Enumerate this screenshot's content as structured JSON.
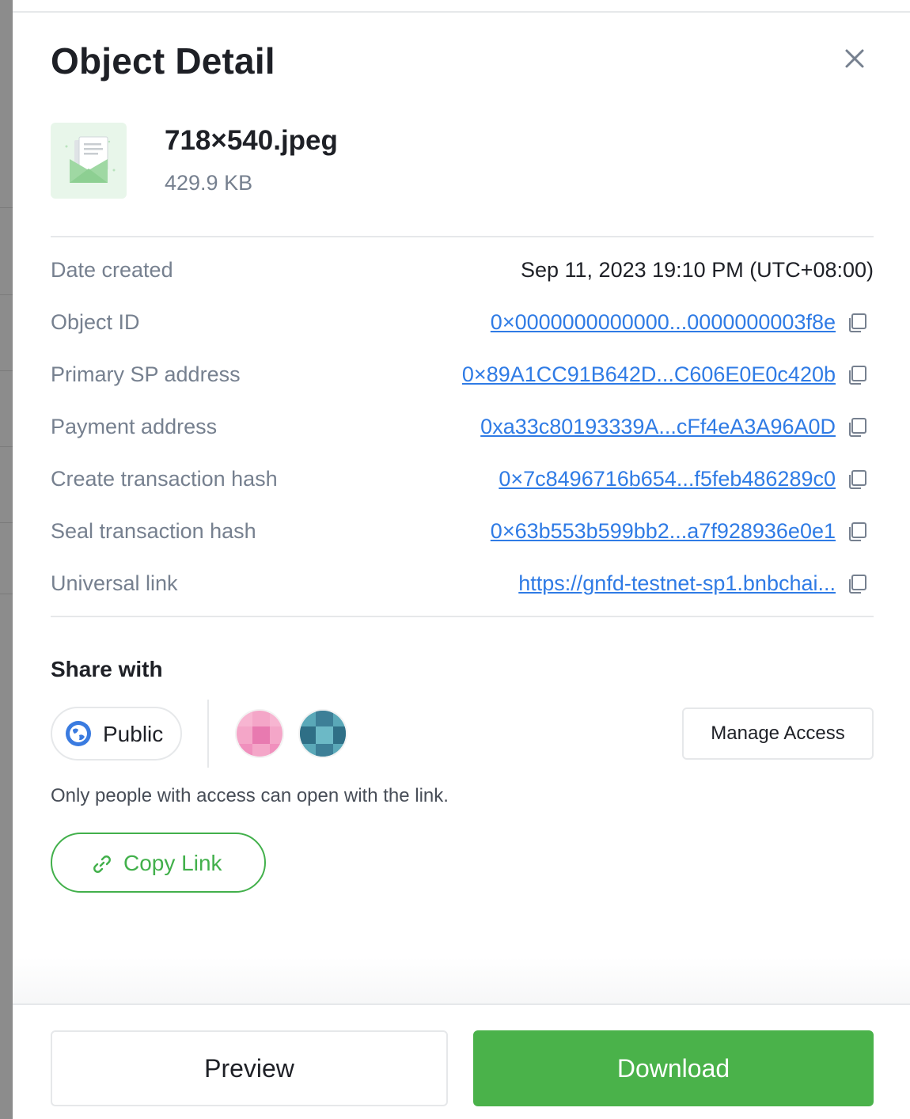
{
  "drawer": {
    "title": "Object Detail",
    "close_icon": "close-icon"
  },
  "file": {
    "name": "718×540.jpeg",
    "size": "429.9 KB",
    "thumbnail_icon": "file-envelope-icon"
  },
  "details": {
    "date_created": {
      "label": "Date created",
      "value": "Sep 11, 2023 19:10 PM (UTC+08:00)"
    },
    "object_id": {
      "label": "Object ID",
      "value": "0×0000000000000...0000000003f8e"
    },
    "primary_sp_address": {
      "label": "Primary SP address",
      "value": "0×89A1CC91B642D...C606E0E0c420b"
    },
    "payment_address": {
      "label": "Payment address",
      "value": "0xa33c80193339A...cFf4eA3A96A0D"
    },
    "create_tx_hash": {
      "label": "Create transaction hash",
      "value": "0×7c8496716b654...f5feb486289c0"
    },
    "seal_tx_hash": {
      "label": "Seal transaction hash",
      "value": "0×63b553b599bb2...a7f928936e0e1"
    },
    "universal_link": {
      "label": "Universal link",
      "value": "https://gnfd-testnet-sp1.bnbchai..."
    }
  },
  "share": {
    "title": "Share with",
    "public_label": "Public",
    "manage_access_label": "Manage Access",
    "note": "Only people with access can open with the link.",
    "copy_link_label": "Copy Link"
  },
  "footer": {
    "preview_label": "Preview",
    "download_label": "Download"
  },
  "colors": {
    "accent_green": "#4ab24a",
    "link_blue": "#2f7be5",
    "muted_text": "#76808f"
  }
}
